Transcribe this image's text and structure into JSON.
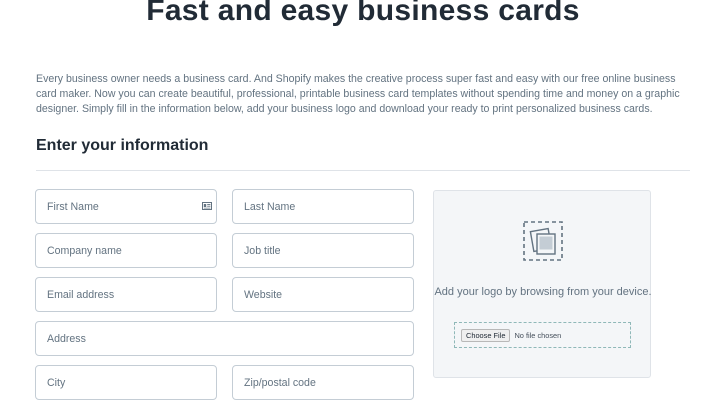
{
  "page": {
    "title": "Fast and easy business cards",
    "intro": "Every business owner needs a business card. And Shopify makes the creative process super fast and easy with our free online business card maker. Now you can create beautiful, professional, printable business card templates without spending time and money on a graphic designer. Simply fill in the information below, add your business logo and download your ready to print personalized business cards."
  },
  "form": {
    "heading": "Enter your information",
    "first_name": "First Name",
    "last_name": "Last Name",
    "company": "Company name",
    "job_title": "Job title",
    "email": "Email address",
    "website": "Website",
    "address": "Address",
    "city": "City",
    "zip": "Zip/postal code"
  },
  "upload": {
    "icon": "image-upload-icon",
    "prompt": "Add your logo by browsing from your device.",
    "button": "Choose File",
    "status": "No file chosen"
  },
  "icons": {
    "first_name_field": "contact-card-icon"
  },
  "colors": {
    "text": "#212b36",
    "muted": "#637381",
    "border": "#c4cdd5",
    "panel": "#f4f6f8"
  }
}
